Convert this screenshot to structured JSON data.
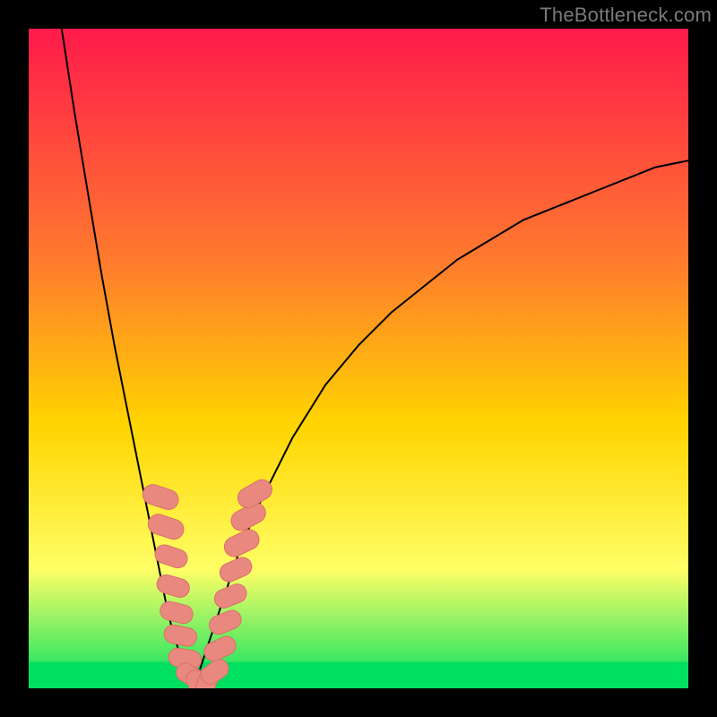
{
  "watermark": "TheBottleneck.com",
  "colors": {
    "gradient_top": "#ff1a4b",
    "gradient_mid1": "#ff7a2e",
    "gradient_mid2": "#ffd400",
    "gradient_mid3": "#ffff66",
    "gradient_bottom": "#00e060",
    "curve": "#000000",
    "marker_fill": "#e9887f",
    "marker_stroke": "#d97168"
  },
  "chart_data": {
    "type": "line",
    "title": "",
    "xlabel": "",
    "ylabel": "",
    "xlim": [
      0,
      100
    ],
    "ylim": [
      0,
      100
    ],
    "series": [
      {
        "name": "bottleneck-curve-left",
        "x": [
          5,
          7,
          9,
          11,
          13,
          15,
          17,
          19,
          20,
          21,
          22,
          23,
          24,
          25
        ],
        "y": [
          100,
          87,
          75,
          63,
          52,
          42,
          32,
          22,
          17,
          12,
          8,
          5,
          2,
          0
        ]
      },
      {
        "name": "bottleneck-curve-right",
        "x": [
          25,
          26,
          27,
          28,
          30,
          32,
          35,
          40,
          45,
          50,
          55,
          60,
          65,
          70,
          75,
          80,
          85,
          90,
          95,
          100
        ],
        "y": [
          0,
          3,
          6,
          9,
          15,
          21,
          28,
          38,
          46,
          52,
          57,
          61,
          65,
          68,
          71,
          73,
          75,
          77,
          79,
          80
        ]
      }
    ],
    "markers": [
      {
        "x": 20.0,
        "y": 29.0,
        "w": 3.0,
        "h": 5.5,
        "angle": -72
      },
      {
        "x": 20.8,
        "y": 24.5,
        "w": 3.0,
        "h": 5.5,
        "angle": -72
      },
      {
        "x": 21.6,
        "y": 20.0,
        "w": 2.8,
        "h": 5.0,
        "angle": -72
      },
      {
        "x": 21.9,
        "y": 15.5,
        "w": 2.8,
        "h": 5.0,
        "angle": -74
      },
      {
        "x": 22.4,
        "y": 11.5,
        "w": 2.8,
        "h": 5.0,
        "angle": -76
      },
      {
        "x": 23.0,
        "y": 8.0,
        "w": 2.8,
        "h": 5.0,
        "angle": -78
      },
      {
        "x": 23.7,
        "y": 4.5,
        "w": 2.8,
        "h": 5.0,
        "angle": -80
      },
      {
        "x": 24.5,
        "y": 2.0,
        "w": 2.8,
        "h": 4.5,
        "angle": -60
      },
      {
        "x": 25.5,
        "y": 0.8,
        "w": 2.8,
        "h": 4.0,
        "angle": -20
      },
      {
        "x": 27.0,
        "y": 0.8,
        "w": 2.8,
        "h": 4.0,
        "angle": 20
      },
      {
        "x": 28.2,
        "y": 2.5,
        "w": 2.8,
        "h": 4.5,
        "angle": 55
      },
      {
        "x": 29.0,
        "y": 6.0,
        "w": 2.8,
        "h": 5.0,
        "angle": 65
      },
      {
        "x": 29.8,
        "y": 10.0,
        "w": 2.8,
        "h": 5.0,
        "angle": 68
      },
      {
        "x": 30.6,
        "y": 14.0,
        "w": 2.8,
        "h": 5.0,
        "angle": 68
      },
      {
        "x": 31.4,
        "y": 18.0,
        "w": 2.8,
        "h": 5.0,
        "angle": 66
      },
      {
        "x": 32.3,
        "y": 22.0,
        "w": 3.0,
        "h": 5.5,
        "angle": 64
      },
      {
        "x": 33.3,
        "y": 26.0,
        "w": 3.0,
        "h": 5.5,
        "angle": 62
      },
      {
        "x": 34.3,
        "y": 29.5,
        "w": 3.0,
        "h": 5.5,
        "angle": 60
      }
    ],
    "green_band": {
      "y0": 0,
      "y1": 4
    }
  }
}
